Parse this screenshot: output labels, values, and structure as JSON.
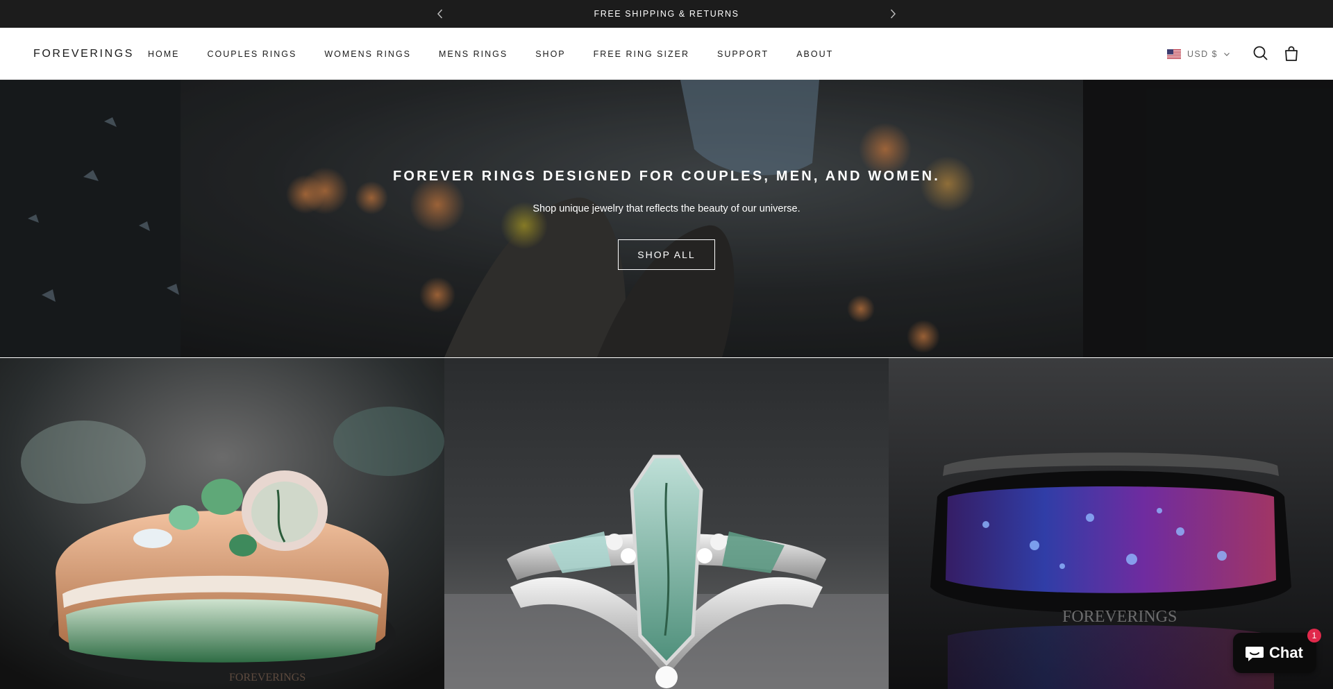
{
  "announcement": {
    "text": "FREE SHIPPING & RETURNS",
    "prev_icon": "chevron-left-icon",
    "next_icon": "chevron-right-icon"
  },
  "header": {
    "logo": "FOREVERINGS",
    "nav": [
      "HOME",
      "COUPLES RINGS",
      "WOMENS RINGS",
      "MENS RINGS",
      "SHOP",
      "FREE RING SIZER",
      "SUPPORT",
      "ABOUT"
    ],
    "currency": "USD $",
    "currency_flag": "us-flag-icon",
    "search_icon": "search-icon",
    "cart_icon": "shopping-bag-icon"
  },
  "hero": {
    "title": "FOREVER RINGS DESIGNED FOR COUPLES, MEN, AND WOMEN.",
    "subtitle": "Shop unique jewelry that reflects the beauty of our universe.",
    "cta": "SHOP ALL"
  },
  "tiles": [
    {
      "name": "rose-gold-moss-agate-ring-set",
      "watermark": "FOREVERINGS"
    },
    {
      "name": "silver-moss-agate-ring-set",
      "watermark": ""
    },
    {
      "name": "black-galaxy-opal-band",
      "watermark": "FOREVERINGS"
    }
  ],
  "chat": {
    "label": "Chat",
    "badge": "1",
    "icon": "chat-bubble-icon"
  },
  "colors": {
    "announcement_bg": "#1c1c1c",
    "chat_bg": "#0b0b0b",
    "badge": "#e0294b"
  }
}
